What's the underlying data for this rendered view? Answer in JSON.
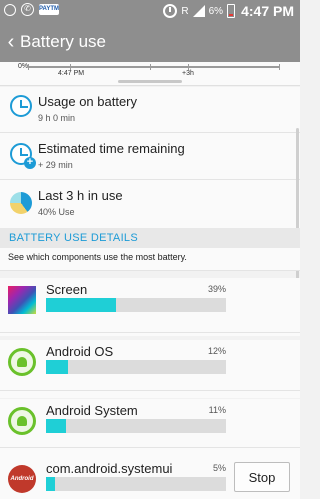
{
  "status_bar": {
    "left_icons": [
      "notification-icon",
      "whatsapp-icon",
      "paytm-icon"
    ],
    "paytm_label": "PAYTM",
    "signal_label": "R",
    "battery_percent": "6%",
    "time": "4:47 PM"
  },
  "app_bar": {
    "title": "Battery use"
  },
  "graph": {
    "y_start": "0%",
    "x_labels": [
      "4:47 PM",
      "+3h"
    ]
  },
  "summary": [
    {
      "title": "Usage on battery",
      "subtitle": "9 h 0 min",
      "icon": "clock-icon"
    },
    {
      "title": "Estimated time remaining",
      "subtitle": "+ 29 min",
      "icon": "clock-plus-icon"
    },
    {
      "title": "Last 3 h in use",
      "subtitle": "40% Use",
      "icon": "pie-chart-icon"
    }
  ],
  "section": {
    "header": "BATTERY USE DETAILS",
    "description": "See which components use the most battery."
  },
  "apps": [
    {
      "name": "Screen",
      "percent": "39%",
      "level": 0.39,
      "icon": "screen-icon"
    },
    {
      "name": "Android OS",
      "percent": "12%",
      "level": 0.12,
      "icon": "android-icon"
    },
    {
      "name": "Android System",
      "percent": "11%",
      "level": 0.11,
      "icon": "android-icon"
    },
    {
      "name": "com.android.systemui",
      "percent": "5%",
      "level": 0.05,
      "icon": "kitkat-icon",
      "icon_label": "Android",
      "action": "Stop"
    }
  ],
  "colors": {
    "accent": "#1d9bd6",
    "bar_fill": "#1fcfd6",
    "bar_track": "#dcdcdc",
    "header_bg": "#8e8e8e"
  }
}
